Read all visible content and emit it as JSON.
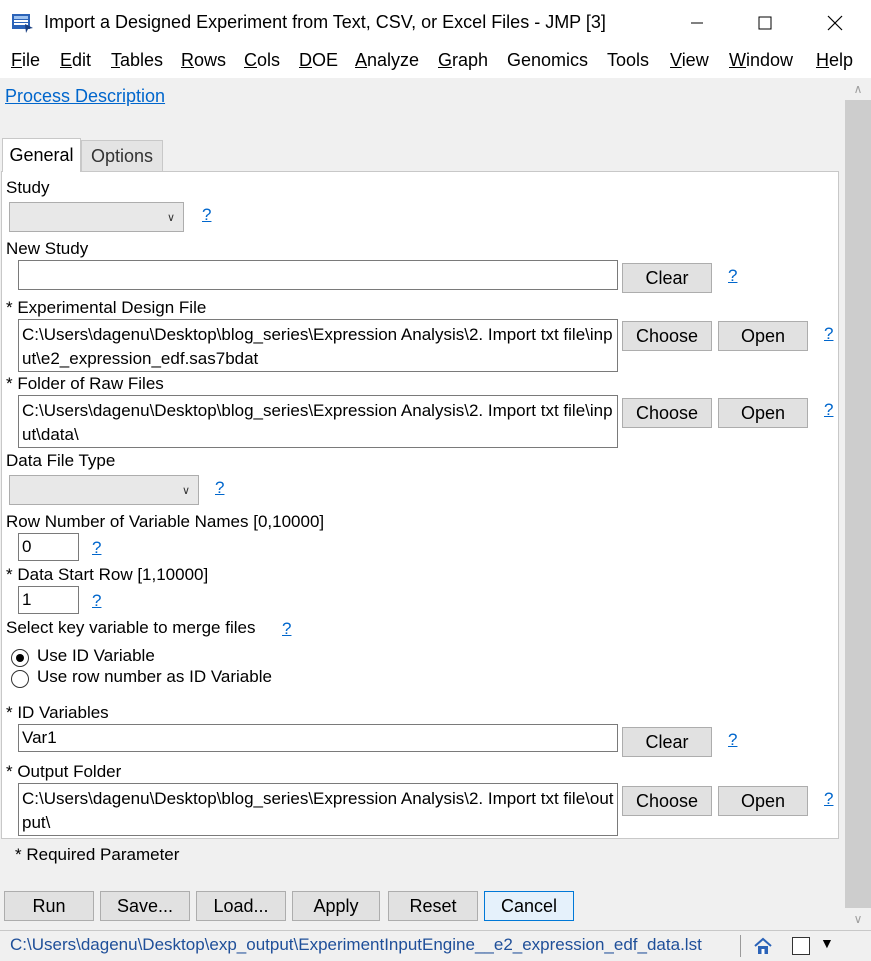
{
  "window": {
    "title": "Import a Designed Experiment from Text, CSV, or Excel Files - JMP [3]"
  },
  "menubar": [
    {
      "u": "F",
      "rest": "ile"
    },
    {
      "u": "E",
      "rest": "dit"
    },
    {
      "u": "T",
      "rest": "ables"
    },
    {
      "u": "R",
      "rest": "ows"
    },
    {
      "u": "C",
      "rest": "ols"
    },
    {
      "u": "D",
      "rest": "OE"
    },
    {
      "u": "A",
      "rest": "nalyze"
    },
    {
      "u": "G",
      "rest": "raph"
    },
    {
      "u": "",
      "rest": "Genomics"
    },
    {
      "u": "",
      "rest": "Tools"
    },
    {
      "u": "V",
      "rest": "iew"
    },
    {
      "u": "W",
      "rest": "indow"
    },
    {
      "u": "H",
      "rest": "elp"
    }
  ],
  "process_link": "Process Description",
  "tabs": {
    "general": "General",
    "options": "Options"
  },
  "help_glyph": "?",
  "study": {
    "label": "Study",
    "value": ""
  },
  "new_study": {
    "label": "New Study",
    "value": "",
    "clear": "Clear"
  },
  "design_file": {
    "label": "* Experimental Design File",
    "value": "C:\\Users\\dagenu\\Desktop\\blog_series\\Expression Analysis\\2. Import txt file\\input\\e2_expression_edf.sas7bdat",
    "choose": "Choose",
    "open": "Open"
  },
  "raw_folder": {
    "label": "* Folder of Raw Files",
    "value": "C:\\Users\\dagenu\\Desktop\\blog_series\\Expression Analysis\\2. Import txt file\\input\\data\\",
    "choose": "Choose",
    "open": "Open"
  },
  "data_file_type": {
    "label": "Data File Type",
    "value": ""
  },
  "row_var_names": {
    "label": "Row Number of Variable Names [0,10000]",
    "value": "0"
  },
  "data_start_row": {
    "label": "* Data Start Row [1,10000]",
    "value": "1"
  },
  "key_variable": {
    "label": "Select key variable to merge files",
    "options": [
      "Use ID Variable",
      "Use row number as ID Variable"
    ],
    "selected": 0
  },
  "id_variables": {
    "label": "* ID Variables",
    "value": "Var1",
    "clear": "Clear"
  },
  "output_folder": {
    "label": "* Output Folder",
    "value": "C:\\Users\\dagenu\\Desktop\\blog_series\\Expression Analysis\\2. Import txt file\\output\\",
    "choose": "Choose",
    "open": "Open"
  },
  "required_note": "* Required Parameter",
  "actions": {
    "run": "Run",
    "save": "Save...",
    "load": "Load...",
    "apply": "Apply",
    "reset": "Reset",
    "cancel": "Cancel"
  },
  "status": {
    "path": "C:\\Users\\dagenu\\Desktop\\exp_output\\ExperimentInputEngine__e2_expression_edf_data.lst"
  },
  "colors": {
    "link": "#0066cc",
    "status_text": "#1f4f99",
    "primary_button_border": "#0078d7"
  }
}
